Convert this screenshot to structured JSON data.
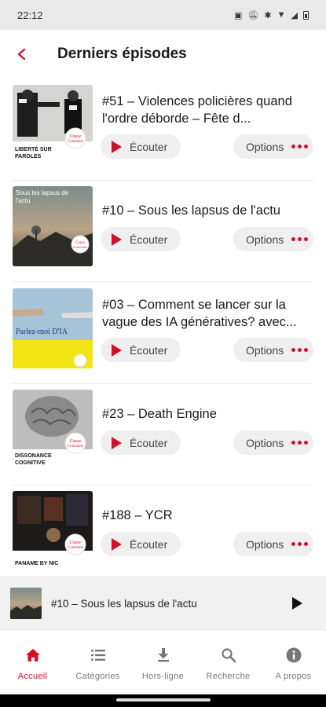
{
  "status_bar": {
    "time": "22:12"
  },
  "header": {
    "title": "Derniers épisodes"
  },
  "colors": {
    "accent": "#d3102a"
  },
  "episodes": [
    {
      "title": "#51 – Violences policières quand l'ordre déborde – Fête d...",
      "listen_label": "Écouter",
      "options_label": "Options",
      "thumb_text": "LIBERTÉ SUR PAROLES",
      "thumb_theme": "bw"
    },
    {
      "title": "#10 – Sous les lapsus de l'actu",
      "listen_label": "Écouter",
      "options_label": "Options",
      "thumb_text": "Sous les lapsus de l'actu",
      "thumb_theme": "sky"
    },
    {
      "title": "#03 – Comment se lancer sur la vague des IA génératives? avec...",
      "listen_label": "Écouter",
      "options_label": "Options",
      "thumb_text": "Parlez-moi D'IA",
      "thumb_theme": "yellow"
    },
    {
      "title": "#23 – Death Engine",
      "listen_label": "Écouter",
      "options_label": "Options",
      "thumb_text": "DISSONANCE COGNITIVE",
      "thumb_theme": "brain"
    },
    {
      "title": "#188 – YCR",
      "listen_label": "Écouter",
      "options_label": "Options",
      "thumb_text": "PANAME BY NIC",
      "thumb_theme": "dark"
    }
  ],
  "mini_player": {
    "title": "#10 – Sous les lapsus de l'actu"
  },
  "bottom_nav": [
    {
      "label": "Accueil",
      "icon": "home-icon",
      "active": true
    },
    {
      "label": "Catégories",
      "icon": "list-icon",
      "active": false
    },
    {
      "label": "Hors-ligne",
      "icon": "download-icon",
      "active": false
    },
    {
      "label": "Recherche",
      "icon": "search-icon",
      "active": false
    },
    {
      "label": "A propos",
      "icon": "info-icon",
      "active": false
    }
  ]
}
